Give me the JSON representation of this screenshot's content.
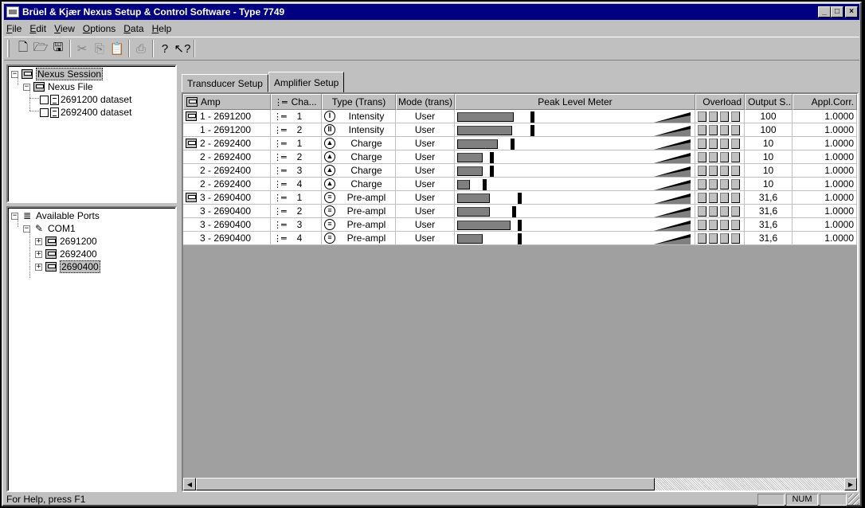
{
  "window": {
    "title": "Brüel & Kjær Nexus Setup & Control Software - Type 7749",
    "minimize_glyph": "_",
    "maximize_glyph": "□",
    "close_glyph": "×"
  },
  "menu": [
    "File",
    "Edit",
    "View",
    "Options",
    "Data",
    "Help"
  ],
  "menu_underline": [
    "F",
    "E",
    "V",
    "O",
    "D",
    "H"
  ],
  "toolbar": {
    "new_glyph": "🗋",
    "open_glyph": "🗁",
    "save_glyph": "🖫",
    "cut_glyph": "✂",
    "copy_glyph": "⎘",
    "paste_glyph": "📋",
    "print_glyph": "⎙",
    "help_glyph": "?",
    "context_help_glyph": "↖?"
  },
  "session_tree": {
    "session_label": "Nexus Session",
    "file_label": "Nexus File",
    "datasets": [
      "2691200 dataset",
      "2692400 dataset"
    ]
  },
  "ports_tree": {
    "root_label": "Available Ports",
    "port_label": "COM1",
    "devices": [
      "2691200",
      "2692400",
      "2690400"
    ]
  },
  "tabs": [
    {
      "label": "Transducer Setup"
    },
    {
      "label": "Amplifier Setup"
    }
  ],
  "grid": {
    "headers": {
      "amp": "Amp",
      "channel": "Cha...",
      "type": "Type (Trans)",
      "mode": "Mode (trans)",
      "meter": "Peak Level Meter",
      "overload": "Overload",
      "output": "Output S...",
      "corr": "Appl.Corr."
    },
    "rows": [
      {
        "amp": "1 - 2691200",
        "channel": "1",
        "type": "Intensity",
        "type_glyph": "I",
        "mode": "User",
        "level": 0.31,
        "peak": 0.4,
        "output": "100",
        "corr": "1.0000",
        "first": true
      },
      {
        "amp": "1 - 2691200",
        "channel": "2",
        "type": "Intensity",
        "type_glyph": "II",
        "mode": "User",
        "level": 0.3,
        "peak": 0.4,
        "output": "100",
        "corr": "1.0000",
        "first": false
      },
      {
        "amp": "2 - 2692400",
        "channel": "1",
        "type": "Charge",
        "type_glyph": "▲",
        "mode": "User",
        "level": 0.22,
        "peak": 0.29,
        "output": "10",
        "corr": "1.0000",
        "first": true
      },
      {
        "amp": "2 - 2692400",
        "channel": "2",
        "type": "Charge",
        "type_glyph": "▲",
        "mode": "User",
        "level": 0.14,
        "peak": 0.18,
        "output": "10",
        "corr": "1.0000",
        "first": false
      },
      {
        "amp": "2 - 2692400",
        "channel": "3",
        "type": "Charge",
        "type_glyph": "▲",
        "mode": "User",
        "level": 0.14,
        "peak": 0.18,
        "output": "10",
        "corr": "1.0000",
        "first": false
      },
      {
        "amp": "2 - 2692400",
        "channel": "4",
        "type": "Charge",
        "type_glyph": "▲",
        "mode": "User",
        "level": 0.07,
        "peak": 0.14,
        "output": "10",
        "corr": "1.0000",
        "first": false
      },
      {
        "amp": "3 - 2690400",
        "channel": "1",
        "type": "Pre-ampl",
        "type_glyph": "≡",
        "mode": "User",
        "level": 0.18,
        "peak": 0.33,
        "output": "31,6",
        "corr": "1.0000",
        "first": true
      },
      {
        "amp": "3 - 2690400",
        "channel": "2",
        "type": "Pre-ampl",
        "type_glyph": "≡",
        "mode": "User",
        "level": 0.18,
        "peak": 0.3,
        "output": "31,6",
        "corr": "1.0000",
        "first": false
      },
      {
        "amp": "3 - 2690400",
        "channel": "3",
        "type": "Pre-ampl",
        "type_glyph": "≡",
        "mode": "User",
        "level": 0.29,
        "peak": 0.33,
        "output": "31,6",
        "corr": "1.0000",
        "first": false
      },
      {
        "amp": "3 - 2690400",
        "channel": "4",
        "type": "Pre-ampl",
        "type_glyph": "≡",
        "mode": "User",
        "level": 0.14,
        "peak": 0.33,
        "output": "31,6",
        "corr": "1.0000",
        "first": false
      }
    ]
  },
  "status": {
    "help_text": "For Help, press F1",
    "num_indicator": "NUM"
  },
  "colors": {
    "titlebar": "#000080",
    "face": "#c0c0c0",
    "meter_bar": "#808080"
  }
}
